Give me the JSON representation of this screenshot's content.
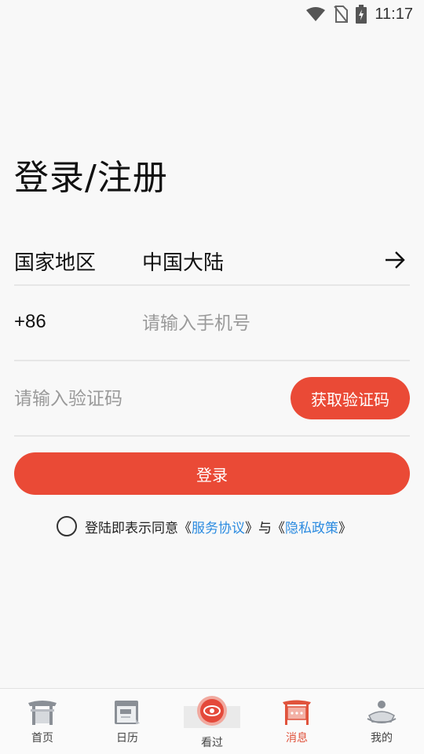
{
  "status_bar": {
    "time": "11:17"
  },
  "login": {
    "title": "登录/注册",
    "region_label": "国家地区",
    "region_value": "中国大陆",
    "phone_prefix": "+86",
    "phone_placeholder": "请输入手机号",
    "code_placeholder": "请输入验证码",
    "get_code_label": "获取验证码",
    "login_label": "登录"
  },
  "agreement": {
    "prefix": "登陆即表示同意",
    "open_quote_1": "《",
    "service_link": "服务协议",
    "close_quote_1": "》",
    "middle": "与",
    "open_quote_2": "《",
    "privacy_link": "隐私政策",
    "close_quote_2": "》"
  },
  "tabs": [
    {
      "label": "首页",
      "icon": "gate-icon"
    },
    {
      "label": "日历",
      "icon": "calendar-icon"
    },
    {
      "label": "看过",
      "icon": "eye-icon"
    },
    {
      "label": "消息",
      "icon": "message-board-icon"
    },
    {
      "label": "我的",
      "icon": "profile-icon"
    }
  ],
  "colors": {
    "accent": "#ea4a36",
    "link": "#2b8be0",
    "active_tab": "#e0533c"
  }
}
